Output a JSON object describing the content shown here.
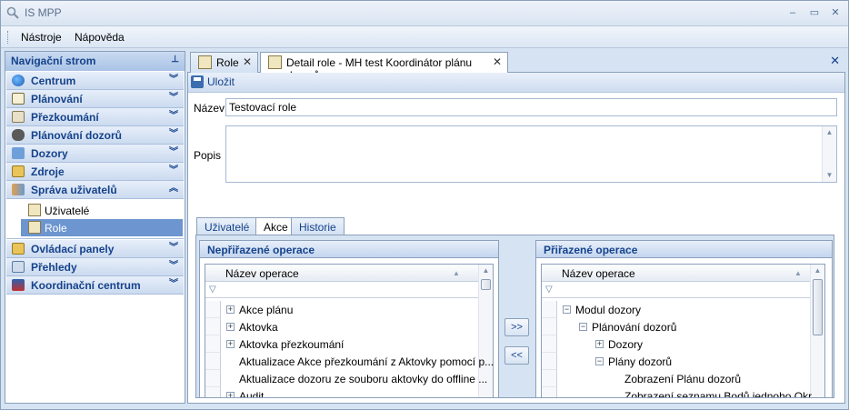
{
  "app": {
    "title": "IS MPP"
  },
  "window_controls": {
    "minimize": "–",
    "restore": "▭",
    "close": "✕"
  },
  "menu": {
    "items": [
      "Nástroje",
      "Nápověda"
    ]
  },
  "nav": {
    "header": "Navigační strom",
    "groups": [
      {
        "label": "Centrum",
        "icon": "globe-icon",
        "state": "collapsed"
      },
      {
        "label": "Plánování",
        "icon": "calendar-icon",
        "state": "collapsed"
      },
      {
        "label": "Přezkoumání",
        "icon": "magnifier-icon",
        "state": "collapsed"
      },
      {
        "label": "Plánování dozorů",
        "icon": "handshake-icon",
        "state": "collapsed"
      },
      {
        "label": "Dozory",
        "icon": "inspect-icon",
        "state": "collapsed"
      },
      {
        "label": "Zdroje",
        "icon": "folder-icon",
        "state": "collapsed"
      },
      {
        "label": "Správa uživatelů",
        "icon": "users-icon",
        "state": "expanded"
      },
      {
        "label": "Ovládací panely",
        "icon": "panel-icon",
        "state": "collapsed"
      },
      {
        "label": "Přehledy",
        "icon": "report-icon",
        "state": "collapsed"
      },
      {
        "label": "Koordinační centrum",
        "icon": "coordination-icon",
        "state": "collapsed"
      }
    ],
    "sub_items": [
      {
        "label": "Uživatelé",
        "selected": false
      },
      {
        "label": "Role",
        "selected": true
      }
    ]
  },
  "tabs": [
    {
      "label": "Role",
      "active": false
    },
    {
      "label": "Detail role - MH test Koordinátor plánu dozorů",
      "active": true
    }
  ],
  "toolbar": {
    "save_label": "Uložit"
  },
  "form": {
    "name_label": "Název",
    "name_value": "Testovací role",
    "desc_label": "Popis",
    "desc_value": ""
  },
  "inner_tabs": [
    {
      "label": "Uživatelé",
      "active": false
    },
    {
      "label": "Akce",
      "active": true
    },
    {
      "label": "Historie",
      "active": false
    }
  ],
  "unassigned": {
    "title": "Nepřiřazené operace",
    "column": "Název operace",
    "rows": [
      {
        "label": "Akce plánu",
        "expandable": true
      },
      {
        "label": "Aktovka",
        "expandable": true
      },
      {
        "label": "Aktovka přezkoumání",
        "expandable": true
      },
      {
        "label": "Aktualizace Akce přezkoumání z Aktovky pomocí p...",
        "expandable": false
      },
      {
        "label": "Aktualizace dozoru ze souboru aktovky do offline ...",
        "expandable": false
      },
      {
        "label": "Audit",
        "expandable": true
      }
    ]
  },
  "assigned": {
    "title": "Přiřazené operace",
    "column": "Název operace",
    "rows": [
      {
        "label": "Modul dozory",
        "level": 0,
        "expander": "−"
      },
      {
        "label": "Plánování dozorů",
        "level": 1,
        "expander": "−"
      },
      {
        "label": "Dozory",
        "level": 2,
        "expander": "+"
      },
      {
        "label": "Plány dozorů",
        "level": 2,
        "expander": "−"
      },
      {
        "label": "Zobrazení Plánu dozorů",
        "level": 3,
        "expander": ""
      },
      {
        "label": "Zobrazení seznamu Bodů jednoho Okr...",
        "level": 3,
        "expander": ""
      }
    ]
  },
  "move_buttons": {
    "assign": ">>",
    "unassign": "<<"
  },
  "colors": {
    "accent": "#15428b",
    "selected": "#6d95cf",
    "background": "#d6e3f2"
  }
}
